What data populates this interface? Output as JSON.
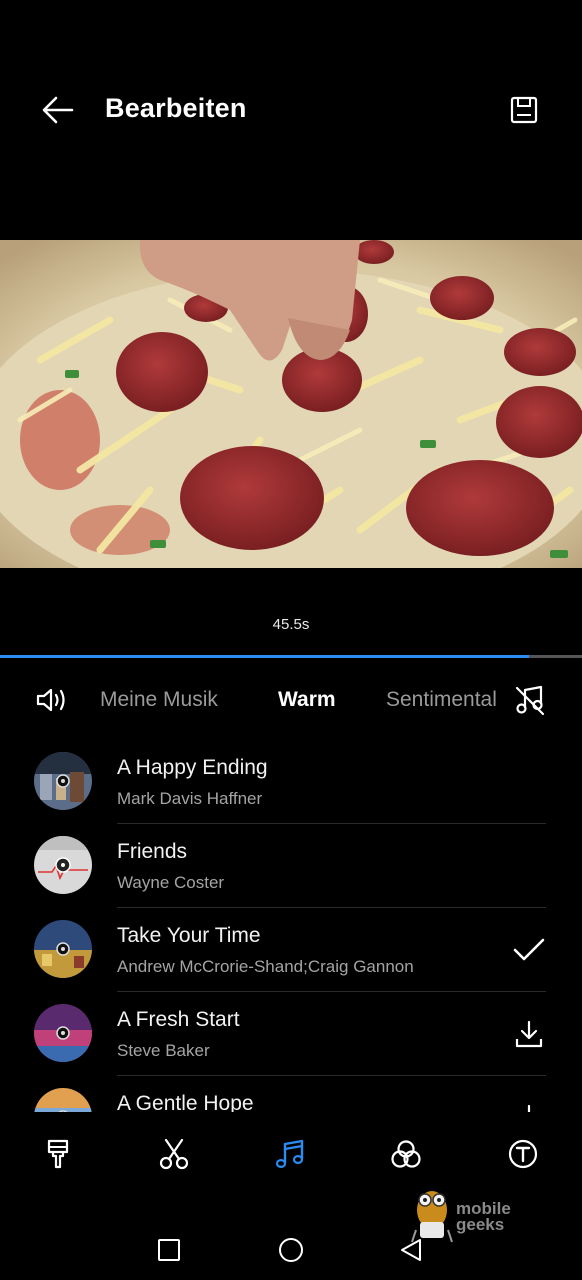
{
  "header": {
    "title": "Bearbeiten",
    "back_icon": "arrow-left-icon",
    "save_icon": "floppy-disk-icon"
  },
  "preview": {
    "description_icon": "video-preview",
    "duration": "45.5s",
    "progress_fraction": 0.91
  },
  "music_tabs": {
    "volume_icon": "speaker-icon",
    "no_music_icon": "music-off-icon",
    "items": [
      {
        "label": "Meine Musik",
        "active": false
      },
      {
        "label": "Warm",
        "active": true
      },
      {
        "label": "Sentimental",
        "active": false
      }
    ]
  },
  "songs": [
    {
      "title": "A Happy Ending",
      "artist": "Mark Davis Haffner",
      "action": ""
    },
    {
      "title": "Friends",
      "artist": "Wayne Coster",
      "action": ""
    },
    {
      "title": "Take Your Time",
      "artist": "Andrew McCrorie-Shand;Craig Gannon",
      "action": "check-icon"
    },
    {
      "title": "A Fresh Start",
      "artist": "Steve  Baker",
      "action": "download-icon"
    },
    {
      "title": "A Gentle Hope",
      "artist": "",
      "action": "download-icon"
    }
  ],
  "toolbar": {
    "items": [
      {
        "icon": "paint-brush-icon",
        "active": false
      },
      {
        "icon": "scissors-icon",
        "active": false
      },
      {
        "icon": "music-note-icon",
        "active": true
      },
      {
        "icon": "filters-icon",
        "active": false
      },
      {
        "icon": "text-icon",
        "active": false
      }
    ],
    "accent_color": "#2b8cf3"
  },
  "navbar": {
    "recents_icon": "square-icon",
    "home_icon": "circle-icon",
    "back_icon": "triangle-back-icon"
  },
  "watermark": {
    "line1": "mobile",
    "line2": "geeks"
  }
}
